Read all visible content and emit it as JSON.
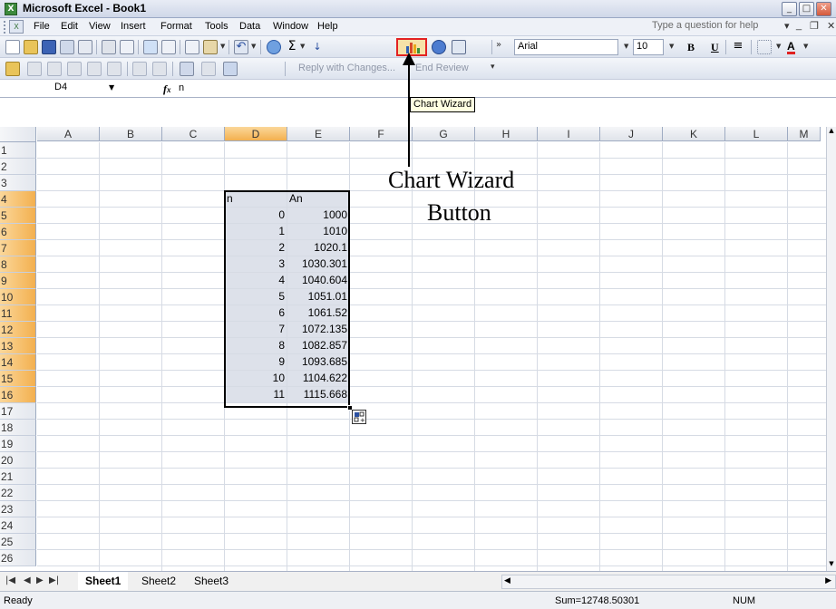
{
  "window": {
    "title": "Microsoft Excel - Book1"
  },
  "menu": {
    "items": [
      "File",
      "Edit",
      "View",
      "Insert",
      "Format",
      "Tools",
      "Data",
      "Window",
      "Help"
    ],
    "help_placeholder": "Type a question for help"
  },
  "toolbar": {
    "font_name": "Arial",
    "font_size": "10",
    "bold": "B",
    "underline": "U",
    "font_color_label": "A",
    "reply_with_changes": "Reply with Changes...",
    "end_review": "End Review",
    "chart_wizard_tooltip": "Chart Wizard"
  },
  "formula_bar": {
    "name_box": "D4",
    "fx": "fx",
    "content": "n"
  },
  "columns": [
    "A",
    "B",
    "C",
    "D",
    "E",
    "F",
    "G",
    "H",
    "I",
    "J",
    "K",
    "L",
    "M"
  ],
  "selected_column": "D",
  "rows": [
    "1",
    "2",
    "3",
    "4",
    "5",
    "6",
    "7",
    "8",
    "9",
    "10",
    "11",
    "12",
    "13",
    "14",
    "15",
    "16",
    "17",
    "18",
    "19",
    "20",
    "21",
    "22",
    "23",
    "24",
    "25",
    "26"
  ],
  "table": {
    "headers": [
      "n",
      "An"
    ],
    "rows": [
      [
        "0",
        "1000"
      ],
      [
        "1",
        "1010"
      ],
      [
        "2",
        "1020.1"
      ],
      [
        "3",
        "1030.301"
      ],
      [
        "4",
        "1040.604"
      ],
      [
        "5",
        "1051.01"
      ],
      [
        "6",
        "1061.52"
      ],
      [
        "7",
        "1072.135"
      ],
      [
        "8",
        "1082.857"
      ],
      [
        "9",
        "1093.685"
      ],
      [
        "10",
        "1104.622"
      ],
      [
        "11",
        "1115.668"
      ]
    ]
  },
  "annotation": {
    "line1": "Chart Wizard",
    "line2": "Button"
  },
  "sheets": [
    "Sheet1",
    "Sheet2",
    "Sheet3"
  ],
  "active_sheet": "Sheet1",
  "status": {
    "ready": "Ready",
    "sum": "Sum=12748.50301",
    "num": "NUM"
  },
  "colors": {
    "accent_selection": "#f3b04f",
    "chart_wizard_highlight": "#e32222"
  }
}
